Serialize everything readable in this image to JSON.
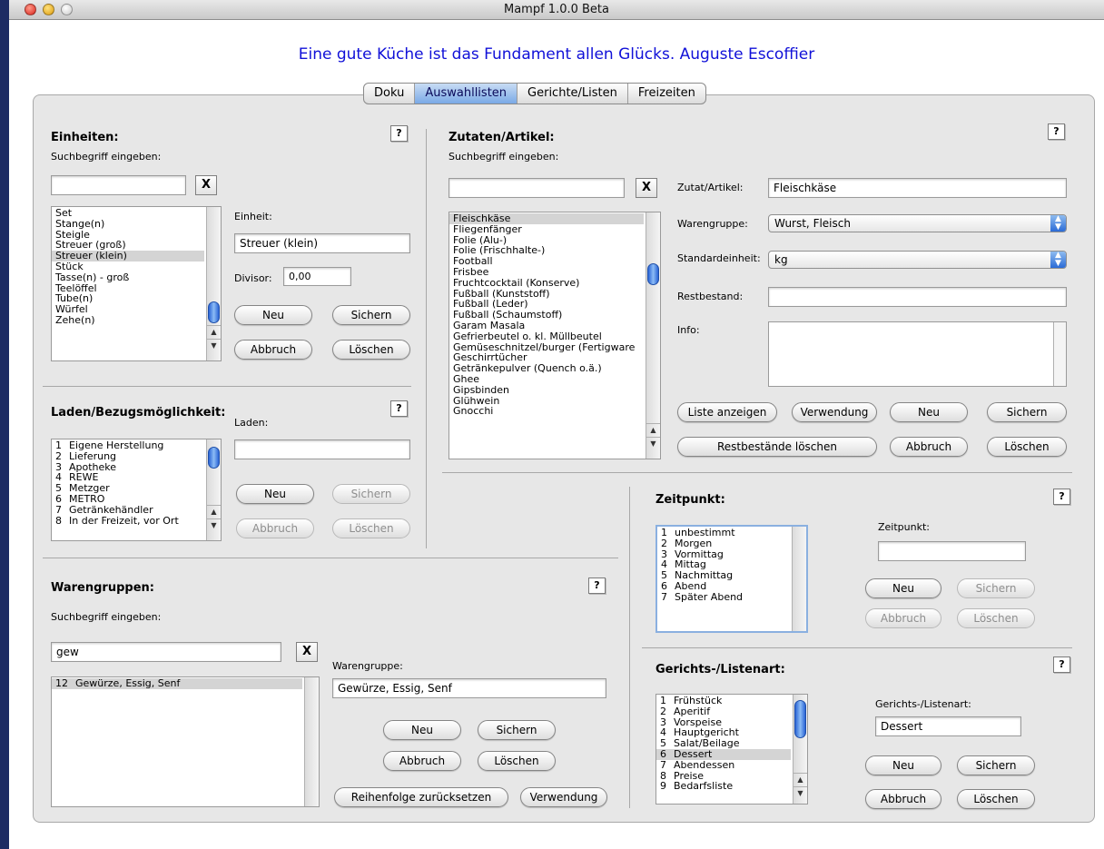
{
  "window": {
    "title": "Mampf 1.0.0 Beta"
  },
  "quote": "Eine gute Küche ist das Fundament allen Glücks. Auguste Escoffier",
  "tabs": [
    "Doku",
    "Auswahllisten",
    "Gerichte/Listen",
    "Freizeiten"
  ],
  "help": "?",
  "clear": "X",
  "einheiten": {
    "title": "Einheiten:",
    "search_label": "Suchbegriff eingeben:",
    "search_value": "",
    "items": [
      "Set",
      "Stange(n)",
      "Steigle",
      "Streuer (groß)",
      "Streuer (klein)",
      "Stück",
      "Tasse(n) - groß",
      "Teelöffel",
      "Tube(n)",
      "Würfel",
      "Zehe(n)"
    ],
    "selected_index": 4,
    "field_label": "Einheit:",
    "field_value": "Streuer (klein)",
    "divisor_label": "Divisor:",
    "divisor_value": "0,00",
    "neu": "Neu",
    "sichern": "Sichern",
    "abbruch": "Abbruch",
    "loeschen": "Löschen"
  },
  "laden": {
    "title": "Laden/Bezugsmöglichkeit:",
    "field_label": "Laden:",
    "field_value": "",
    "items": [
      [
        "1",
        "Eigene Herstellung"
      ],
      [
        "2",
        "Lieferung"
      ],
      [
        "3",
        "Apotheke"
      ],
      [
        "4",
        "REWE"
      ],
      [
        "5",
        "Metzger"
      ],
      [
        "6",
        "METRO"
      ],
      [
        "7",
        "Getränkehändler"
      ],
      [
        "8",
        "In der Freizeit, vor Ort"
      ]
    ],
    "neu": "Neu",
    "sichern": "Sichern",
    "abbruch": "Abbruch",
    "loeschen": "Löschen"
  },
  "warengruppen": {
    "title": "Warengruppen:",
    "search_label": "Suchbegriff eingeben:",
    "search_value": "gew",
    "items": [
      [
        "12",
        "Gewürze, Essig, Senf"
      ]
    ],
    "field_label": "Warengruppe:",
    "field_value": "Gewürze, Essig, Senf",
    "neu": "Neu",
    "sichern": "Sichern",
    "abbruch": "Abbruch",
    "loeschen": "Löschen",
    "reset": "Reihenfolge zurücksetzen",
    "verwendung": "Verwendung"
  },
  "zutaten": {
    "title": "Zutaten/Artikel:",
    "search_label": "Suchbegriff eingeben:",
    "search_value": "",
    "items": [
      "Fleischkäse",
      "Fliegenfänger",
      "Folie (Alu-)",
      "Folie (Frischhalte-)",
      "Football",
      "Frisbee",
      "Fruchtcocktail (Konserve)",
      "Fußball (Kunststoff)",
      "Fußball (Leder)",
      "Fußball (Schaumstoff)",
      "Garam Masala",
      "Gefrierbeutel o. kl. Müllbeutel",
      "Gemüseschnitzel/burger (Fertigware",
      "Geschirrtücher",
      "Getränkepulver (Quench o.ä.)",
      "Ghee",
      "Gipsbinden",
      "Glühwein",
      "Gnocchi"
    ],
    "selected_index": 0,
    "artikel_label": "Zutat/Artikel:",
    "artikel_value": "Fleischkäse",
    "warengruppe_label": "Warengruppe:",
    "warengruppe_value": "Wurst, Fleisch",
    "einheit_label": "Standardeinheit:",
    "einheit_value": "kg",
    "rest_label": "Restbestand:",
    "rest_value": "",
    "info_label": "Info:",
    "info_value": "",
    "liste": "Liste anzeigen",
    "verwendung": "Verwendung",
    "neu": "Neu",
    "sichern": "Sichern",
    "rest_loeschen": "Restbestände löschen",
    "abbruch": "Abbruch",
    "loeschen": "Löschen"
  },
  "zeitpunkt": {
    "title": "Zeitpunkt:",
    "field_label": "Zeitpunkt:",
    "field_value": "",
    "items": [
      [
        "1",
        "unbestimmt"
      ],
      [
        "2",
        "Morgen"
      ],
      [
        "3",
        "Vormittag"
      ],
      [
        "4",
        "Mittag"
      ],
      [
        "5",
        "Nachmittag"
      ],
      [
        "6",
        "Abend"
      ],
      [
        "7",
        "Später Abend"
      ]
    ],
    "neu": "Neu",
    "sichern": "Sichern",
    "abbruch": "Abbruch",
    "loeschen": "Löschen"
  },
  "gerichtsart": {
    "title": "Gerichts-/Listenart:",
    "field_label": "Gerichts-/Listenart:",
    "field_value": "Dessert",
    "items": [
      [
        "1",
        "Frühstück"
      ],
      [
        "2",
        "Aperitif"
      ],
      [
        "3",
        "Vorspeise"
      ],
      [
        "4",
        "Hauptgericht"
      ],
      [
        "5",
        "Salat/Beilage"
      ],
      [
        "6",
        "Dessert"
      ],
      [
        "7",
        "Abendessen"
      ],
      [
        "8",
        "Preise"
      ],
      [
        "9",
        "Bedarfsliste"
      ]
    ],
    "selected_index": 5,
    "neu": "Neu",
    "sichern": "Sichern",
    "abbruch": "Abbruch",
    "loeschen": "Löschen"
  }
}
